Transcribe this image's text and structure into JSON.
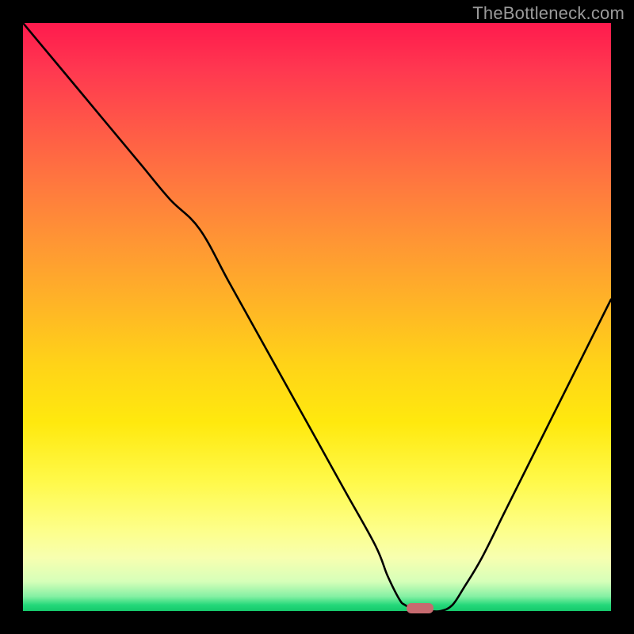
{
  "watermark": "TheBottleneck.com",
  "colors": {
    "frame": "#000000",
    "curve": "#000000",
    "marker": "#c76a6f",
    "gradient_top": "#ff1a4d",
    "gradient_bottom": "#16c96c"
  },
  "chart_data": {
    "type": "line",
    "title": "",
    "xlabel": "",
    "ylabel": "",
    "xlim": [
      0,
      100
    ],
    "ylim": [
      0,
      100
    ],
    "x": [
      0,
      5,
      10,
      15,
      20,
      25,
      30,
      35,
      40,
      45,
      50,
      55,
      60,
      62,
      64,
      65,
      67,
      69,
      71,
      73,
      75,
      78,
      82,
      86,
      90,
      95,
      100
    ],
    "values": [
      100,
      94,
      88,
      82,
      76,
      70,
      65,
      56,
      47,
      38,
      29,
      20,
      11,
      6,
      2,
      1,
      0,
      0,
      0,
      1,
      4,
      9,
      17,
      25,
      33,
      43,
      53
    ],
    "marker_x": 67.5,
    "marker_y": 0,
    "grid": false,
    "legend": false
  }
}
